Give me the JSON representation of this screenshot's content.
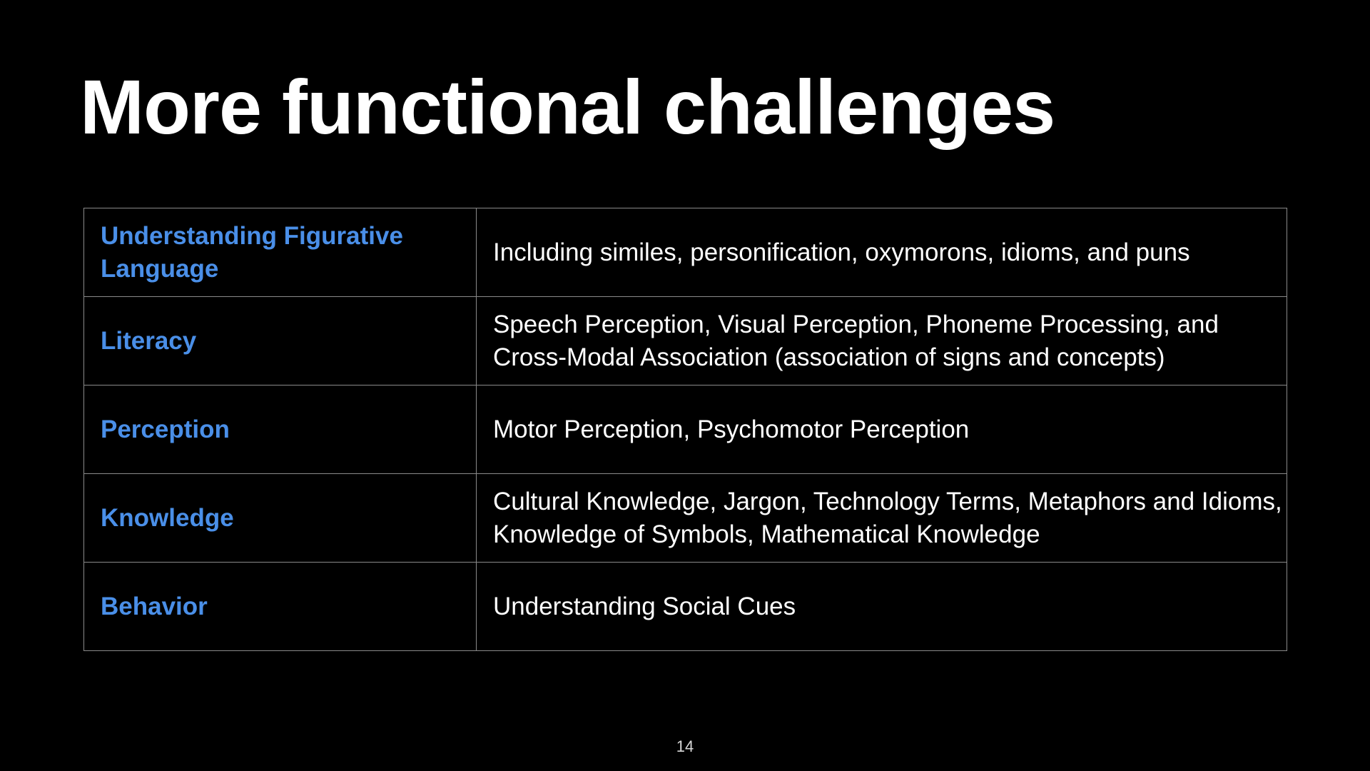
{
  "slide": {
    "title": "More functional challenges",
    "page_number": "14"
  },
  "table": {
    "rows": [
      {
        "category": "Understanding Figurative Language",
        "description": "Including similes, personification, oxymorons, idioms, and puns"
      },
      {
        "category": "Literacy",
        "description": "Speech Perception, Visual Perception, Phoneme Processing, and Cross-Modal Association (association of signs and concepts)"
      },
      {
        "category": "Perception",
        "description": "Motor Perception, Psychomotor Perception"
      },
      {
        "category": "Knowledge",
        "description": "Cultural Knowledge, Jargon, Technology Terms, Metaphors and Idioms, Knowledge of Symbols, Mathematical Knowledge"
      },
      {
        "category": "Behavior",
        "description": "Understanding Social Cues"
      }
    ]
  },
  "colors": {
    "background": "#000000",
    "title": "#ffffff",
    "category_text": "#4a8fe8",
    "description_text": "#ffffff",
    "table_border": "#8a8a8a"
  }
}
